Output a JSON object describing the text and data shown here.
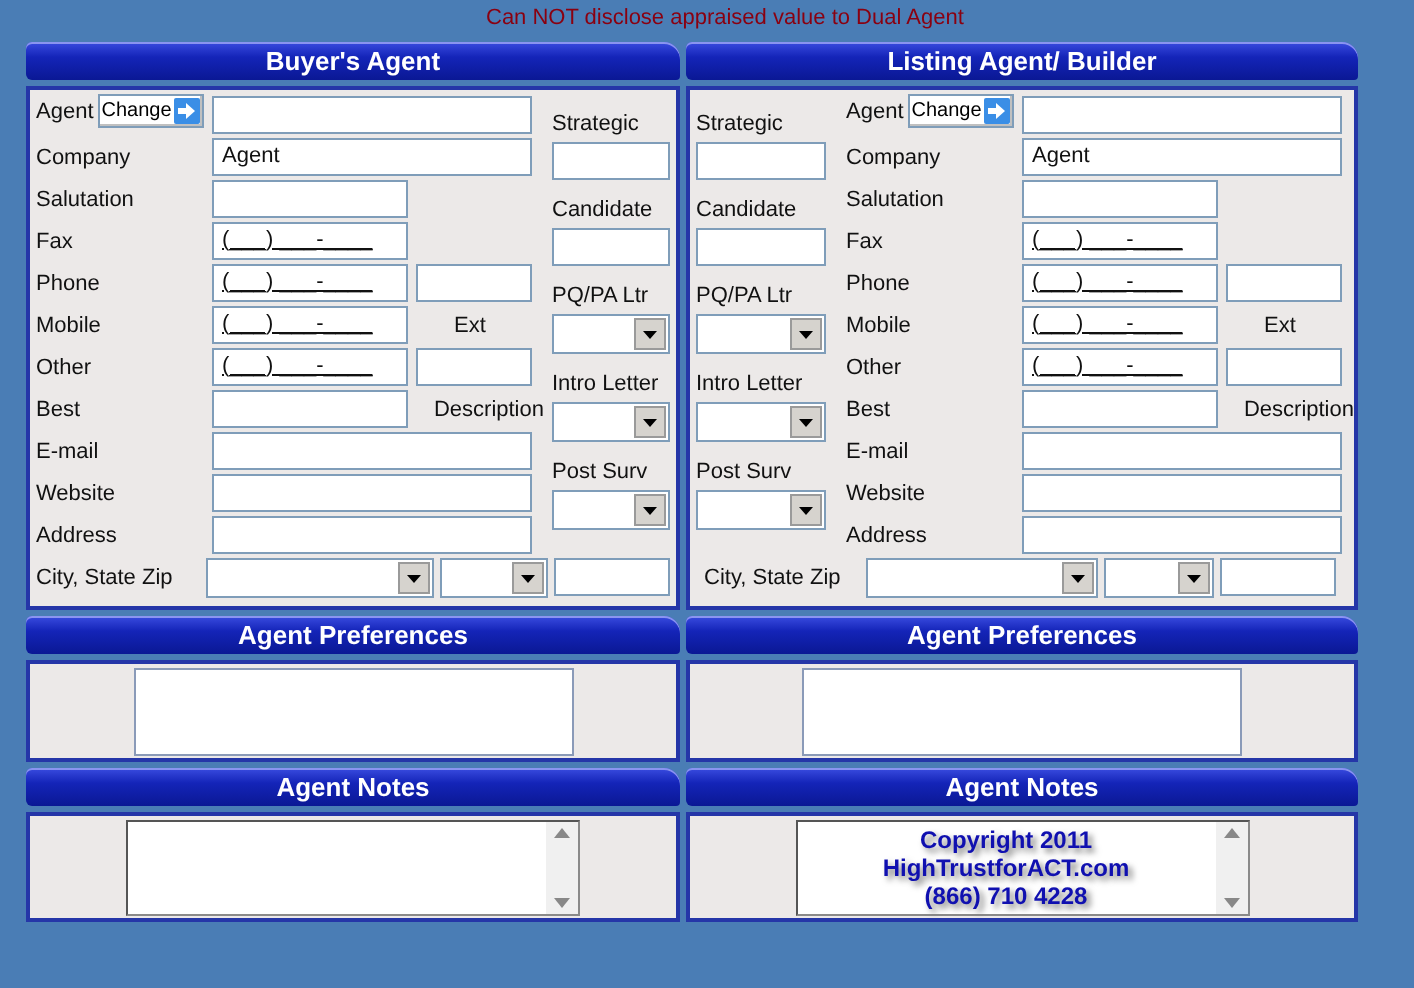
{
  "notice": "Can NOT disclose appraised value to Dual Agent",
  "panels": [
    {
      "title": "Buyer's Agent",
      "side_on_left": false,
      "rows": [
        {
          "kind": "agent",
          "label": "Agent",
          "button": "Change"
        },
        {
          "kind": "wide",
          "label": "Company",
          "value": "Agent"
        },
        {
          "kind": "short",
          "label": "Salutation"
        },
        {
          "kind": "short",
          "label": "Fax",
          "value": "(___) ___-____"
        },
        {
          "kind": "short_field",
          "label": "Phone",
          "value": "(___) ___-____"
        },
        {
          "kind": "short_note",
          "label": "Mobile",
          "value": "(___) ___-____",
          "note": "Ext"
        },
        {
          "kind": "short_field",
          "label": "Other",
          "value": "(___) ___-____"
        },
        {
          "kind": "short_note",
          "label": "Best",
          "note": "Description"
        },
        {
          "kind": "wide",
          "label": "E-mail"
        },
        {
          "kind": "wide",
          "label": "Website"
        },
        {
          "kind": "wide",
          "label": "Address"
        }
      ],
      "side": [
        {
          "kind": "text",
          "label": "Strategic"
        },
        {
          "kind": "text",
          "label": "Candidate"
        },
        {
          "kind": "combo",
          "label": "PQ/PA Ltr"
        },
        {
          "kind": "combo",
          "label": "Intro Letter"
        },
        {
          "kind": "combo",
          "label": "Post Surv"
        }
      ],
      "city": {
        "label": "City, State Zip"
      },
      "preferences": {
        "title": "Agent Preferences"
      },
      "notes": {
        "title": "Agent Notes"
      }
    },
    {
      "title": "Listing Agent/ Builder",
      "side_on_left": true,
      "rows": [
        {
          "kind": "agent",
          "label": "Agent",
          "button": "Change"
        },
        {
          "kind": "wide",
          "label": "Company",
          "value": "Agent"
        },
        {
          "kind": "short",
          "label": "Salutation"
        },
        {
          "kind": "short",
          "label": "Fax",
          "value": "(___) ___-____"
        },
        {
          "kind": "short_field",
          "label": "Phone",
          "value": "(___) ___-____"
        },
        {
          "kind": "short_note",
          "label": "Mobile",
          "value": "(___) ___-____",
          "note": "Ext"
        },
        {
          "kind": "short_field",
          "label": "Other",
          "value": "(___) ___-____"
        },
        {
          "kind": "short_note",
          "label": "Best",
          "note": "Description"
        },
        {
          "kind": "wide",
          "label": "E-mail"
        },
        {
          "kind": "wide",
          "label": "Website"
        },
        {
          "kind": "wide",
          "label": "Address"
        }
      ],
      "side": [
        {
          "kind": "text",
          "label": "Strategic"
        },
        {
          "kind": "text",
          "label": "Candidate"
        },
        {
          "kind": "combo",
          "label": "PQ/PA Ltr"
        },
        {
          "kind": "combo",
          "label": "Intro Letter"
        },
        {
          "kind": "combo",
          "label": "Post Surv"
        }
      ],
      "city": {
        "label": "City, State Zip"
      },
      "preferences": {
        "title": "Agent Preferences"
      },
      "notes": {
        "title": "Agent Notes",
        "overlay_lines": [
          "Copyright 2011",
          "HighTrustforACT.com",
          "(866) 710 4228"
        ]
      }
    }
  ]
}
